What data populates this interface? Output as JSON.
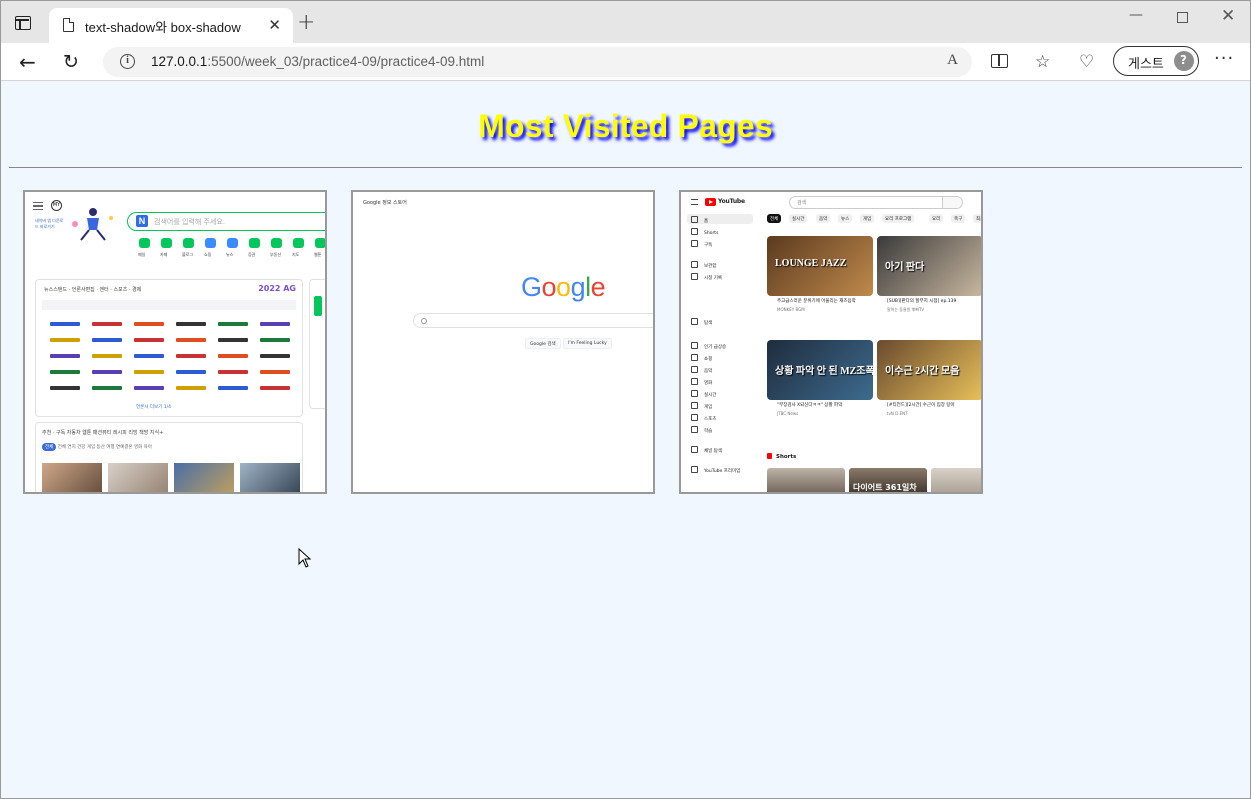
{
  "browser": {
    "tab_title": "text-shadow와 box-shadow",
    "tab_close": "✕",
    "new_tab": "+",
    "url_host": "127.0.0.1",
    "url_path": ":5500/week_03/practice4-09/practice4-09.html",
    "read_aloud": "A",
    "profile_name": "게스트",
    "more": "···"
  },
  "page": {
    "heading": "Most Visited Pages"
  },
  "thumbs": {
    "naver": {
      "logo": "MY",
      "promo": "네이버 앱 다운로드 바로가기",
      "search_placeholder": "검색어를 입력해 주세요.",
      "shortcuts": [
        "메일",
        "카페",
        "블로그",
        "쇼핑",
        "뉴스",
        "증권",
        "부동산",
        "지도",
        "웹툰"
      ],
      "news_tabs": "뉴스스탠드 · 언론사편집 · 엔터 · 스포츠 · 경제",
      "date": "2022 AG",
      "pager": "언론사 더보기 1/4",
      "sub_tabs": "추천 · 구독  자동차  웹툰  패션뷰티  레시피  리빙  책방  지식+",
      "chips": "전체  연지  건강  게임  등산  여행  연예결혼  영화  육아",
      "chips_active": "전체"
    },
    "google": {
      "links": "Google 정보   스토어",
      "logo_letters": [
        "G",
        "o",
        "o",
        "g",
        "l",
        "e"
      ],
      "logo_colors": [
        "#4285f4",
        "#ea4335",
        "#fbbc05",
        "#4285f4",
        "#34a853",
        "#ea4335"
      ],
      "btn_search": "Google 검색",
      "btn_lucky": "I'm Feeling Lucky"
    },
    "youtube": {
      "brand": "YouTube",
      "search_placeholder": "검색",
      "nav": [
        "홈",
        "Shorts",
        "구독",
        "보관함",
        "시청 기록",
        "탐색",
        "인기 급상승",
        "쇼핑",
        "음악",
        "영화",
        "실시간",
        "게임",
        "스포츠",
        "학습",
        "채널 탐색",
        "YouTube 프리미엄"
      ],
      "chips": [
        "전체",
        "실시간",
        "음악",
        "뉴스",
        "게임",
        "요리 프로그램",
        "요리",
        "축구",
        "최근에 업로드"
      ],
      "videos": [
        {
          "title": "LOUNGE JAZZ",
          "caption": "주고급스러운 분위기에 어울리는 재즈음악",
          "meta": "MONKEY BGM",
          "color1": "#5b3a1f",
          "color2": "#c08a4c"
        },
        {
          "title": "아기 판다",
          "caption": "[SUB][판다의 할부지 시점] ep.139",
          "meta": "말하는 동물원 뿌빠TV",
          "color1": "#3a3a3a",
          "color2": "#c9b8a0"
        },
        {
          "title": "상황 파악 안 된 MZ조폭",
          "caption": "\"부장검사 X되신다ㅋㅋ\" 상황 파악",
          "meta": "JTBC News",
          "color1": "#1f2c3d",
          "color2": "#3d6b8f"
        },
        {
          "title": "이수근 2시간 모음",
          "caption": "[#티전드][2시간] 수근이 입장 탕아",
          "meta": "tvN D ENT",
          "color1": "#6a4a2e",
          "color2": "#e8c05a"
        }
      ],
      "shorts_label": "Shorts",
      "short_text": "다이어트 361일차"
    }
  }
}
